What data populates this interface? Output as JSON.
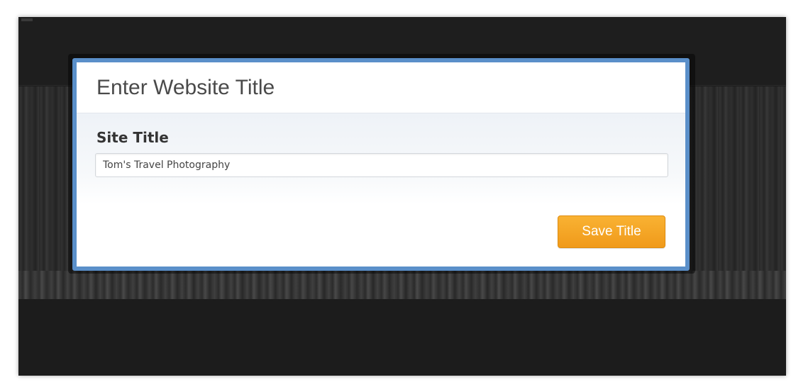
{
  "modal": {
    "title": "Enter Website Title",
    "field": {
      "label": "Site Title",
      "value": "Tom's Travel Photography"
    },
    "save_label": "Save Title"
  },
  "colors": {
    "modal_border": "#5a8fc9",
    "button_orange": "#f09a1a",
    "backdrop": "#1d1d1d"
  }
}
